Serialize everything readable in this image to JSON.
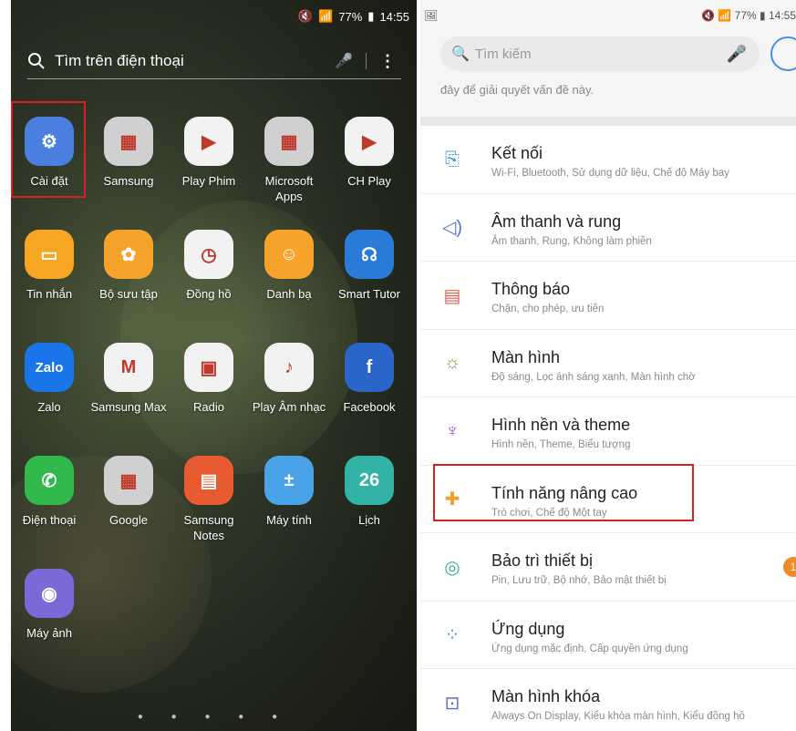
{
  "home": {
    "status": {
      "time": "14:55",
      "battery": "77%"
    },
    "search_placeholder": "Tìm trên điện thoại",
    "apps": [
      {
        "label": "Cài đặt",
        "icon": "gear-icon",
        "color": "#4a7fe0"
      },
      {
        "label": "Samsung",
        "icon": "folder-icon",
        "color": "#d0d0d0"
      },
      {
        "label": "Play Phim",
        "icon": "play-movies-icon",
        "color": "#f2f2f2"
      },
      {
        "label": "Microsoft Apps",
        "icon": "folder-icon",
        "color": "#d0d0d0"
      },
      {
        "label": "CH Play",
        "icon": "play-store-icon",
        "color": "#f2f2f2"
      },
      {
        "label": "Tin nhắn",
        "icon": "message-icon",
        "color": "#f6a623"
      },
      {
        "label": "Bộ sưu tập",
        "icon": "gallery-icon",
        "color": "#f7a32b"
      },
      {
        "label": "Đồng hồ",
        "icon": "clock-icon",
        "color": "#f2f2f2"
      },
      {
        "label": "Danh bạ",
        "icon": "contacts-icon",
        "color": "#f7a32b"
      },
      {
        "label": "Smart Tutor",
        "icon": "headset-icon",
        "color": "#2a7bd8"
      },
      {
        "label": "Zalo",
        "icon": "zalo-icon",
        "color": "#1a76e8"
      },
      {
        "label": "Samsung Max",
        "icon": "samsung-max-icon",
        "color": "#f2f2f2"
      },
      {
        "label": "Radio",
        "icon": "radio-icon",
        "color": "#f2f2f2"
      },
      {
        "label": "Play Âm nhạc",
        "icon": "play-music-icon",
        "color": "#f2f2f2"
      },
      {
        "label": "Facebook",
        "icon": "facebook-icon",
        "color": "#2a66c9"
      },
      {
        "label": "Điện thoại",
        "icon": "phone-icon",
        "color": "#32b94c"
      },
      {
        "label": "Google",
        "icon": "folder-icon",
        "color": "#d0d0d0"
      },
      {
        "label": "Samsung Notes",
        "icon": "notes-icon",
        "color": "#e85a2f"
      },
      {
        "label": "Máy tính",
        "icon": "calculator-icon",
        "color": "#4aa3e8"
      },
      {
        "label": "Lịch",
        "icon": "calendar-icon",
        "color": "#33b3a6"
      },
      {
        "label": "Máy ảnh",
        "icon": "camera-icon",
        "color": "#7a6ad8"
      }
    ],
    "calendar_date": "26"
  },
  "settings": {
    "status": {
      "time": "14:55",
      "battery": "77%"
    },
    "search_placeholder": "Tìm kiếm",
    "partial_text": "đây để giải quyết vấn đề này.",
    "items": [
      {
        "title": "Kết nối",
        "sub": "Wi-Fi, Bluetooth, Sử dụng dữ liệu, Chế độ Máy bay",
        "icon": "connection-icon",
        "color": "#3fa0c8"
      },
      {
        "title": "Âm thanh và rung",
        "sub": "Âm thanh, Rung, Không làm phiền",
        "icon": "volume-icon",
        "color": "#5a6fd0"
      },
      {
        "title": "Thông báo",
        "sub": "Chặn, cho phép, ưu tiên",
        "icon": "notification-icon",
        "color": "#e85a4a"
      },
      {
        "title": "Màn hình",
        "sub": "Độ sáng, Lọc ánh sáng xanh, Màn hình chờ",
        "icon": "display-icon",
        "color": "#6aa84f"
      },
      {
        "title": "Hình nền và theme",
        "sub": "Hình nền, Theme, Biểu tượng",
        "icon": "theme-icon",
        "color": "#9b59b6"
      },
      {
        "title": "Tính năng nâng cao",
        "sub": "Trò chơi, Chế độ Một tay",
        "icon": "advanced-icon",
        "color": "#f0a030"
      },
      {
        "title": "Bảo trì thiết bị",
        "sub": "Pin, Lưu trữ, Bộ nhớ, Bảo mật thiết bị",
        "icon": "maintenance-icon",
        "color": "#2fb3a0",
        "badge": "1"
      },
      {
        "title": "Ứng dụng",
        "sub": "Ứng dụng mặc định, Cấp quyền ứng dụng",
        "icon": "apps-icon",
        "color": "#3fa0c8"
      },
      {
        "title": "Màn hình khóa",
        "sub": "Always On Display, Kiểu khóa màn hình, Kiểu đồng hồ",
        "icon": "lock-screen-icon",
        "color": "#5a6fd0"
      }
    ]
  }
}
